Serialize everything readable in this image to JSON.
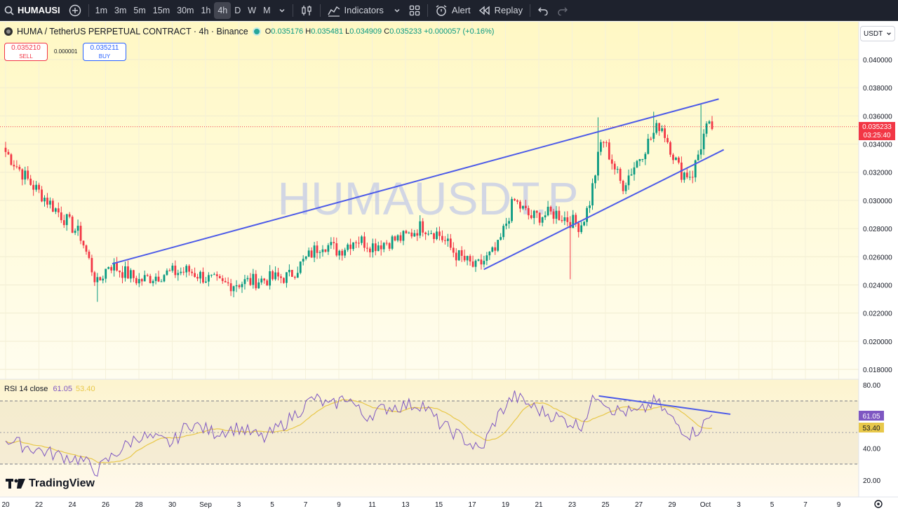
{
  "toolbar": {
    "symbol": "HUMAUSI",
    "intervals": [
      "1m",
      "3m",
      "5m",
      "15m",
      "30m",
      "1h",
      "4h",
      "D",
      "W",
      "M"
    ],
    "active_interval": "4h",
    "indicators_label": "Indicators",
    "alert_label": "Alert",
    "replay_label": "Replay"
  },
  "header": {
    "title": "HUMA / TetherUS PERPETUAL CONTRACT · 4h · Binance",
    "o_label": "O",
    "o": "0.035176",
    "h_label": "H",
    "h": "0.035481",
    "l_label": "L",
    "l": "0.034909",
    "c_label": "C",
    "c": "0.035233",
    "change": "+0.000057 (+0.16%)"
  },
  "trade": {
    "sell_price": "0.035210",
    "sell_label": "SELL",
    "buy_price": "0.035211",
    "buy_label": "BUY",
    "spread": "0.000001"
  },
  "currency": "USDT",
  "watermark": "HUMAUSDT.P",
  "colors": {
    "up": "#089981",
    "down": "#f23645",
    "trendline": "#4d5be8",
    "rsi": "#7e57c2",
    "rsi_ma": "#e8c84a",
    "bg_top": "#fff8c4"
  },
  "rsi": {
    "label": "RSI 14 close",
    "value": "61.05",
    "ma_value": "53.40"
  },
  "branding": "TradingView",
  "chart_data": [
    {
      "type": "candlestick",
      "title": "HUMA / TetherUS PERPETUAL CONTRACT · 4h · Binance",
      "y_ticks": [
        "0.040000",
        "0.038000",
        "0.036000",
        "0.034000",
        "0.032000",
        "0.030000",
        "0.028000",
        "0.026000",
        "0.024000",
        "0.022000",
        "0.020000",
        "0.018000"
      ],
      "x_ticks": [
        "20",
        "22",
        "24",
        "26",
        "28",
        "30",
        "Sep",
        "3",
        "5",
        "7",
        "9",
        "11",
        "13",
        "15",
        "17",
        "19",
        "21",
        "23",
        "25",
        "27",
        "29",
        "Oct",
        "3",
        "5",
        "7",
        "9"
      ],
      "ylim": [
        0.0172,
        0.0412
      ],
      "last_price": "0.035233",
      "countdown": "03:25:40",
      "key_points": [
        {
          "date": "Aug 19",
          "price": 0.0339
        },
        {
          "date": "Aug 22",
          "price": 0.0305
        },
        {
          "date": "Aug 25",
          "price": 0.0235
        },
        {
          "date": "Aug 26",
          "price": 0.0255
        },
        {
          "date": "Sep 2",
          "price": 0.024
        },
        {
          "date": "Sep 8",
          "price": 0.027
        },
        {
          "date": "Sep 13",
          "price": 0.0282
        },
        {
          "date": "Sep 17",
          "price": 0.0251
        },
        {
          "date": "Sep 19",
          "price": 0.0293
        },
        {
          "date": "Sep 22",
          "price": 0.0244
        },
        {
          "date": "Sep 23",
          "price": 0.0359
        },
        {
          "date": "Sep 26",
          "price": 0.0363
        },
        {
          "date": "Sep 28",
          "price": 0.0315
        },
        {
          "date": "Sep 29",
          "price": 0.0368
        },
        {
          "date": "Sep 29",
          "price": 0.0352
        }
      ]
    },
    {
      "type": "line",
      "title": "RSI 14 close",
      "y_ticks": [
        "80.00",
        "40.00",
        "20.00"
      ],
      "ylim": [
        15,
        85
      ],
      "bands": [
        70,
        50,
        30
      ],
      "series": [
        {
          "name": "RSI",
          "last": 61.05
        },
        {
          "name": "RSI-based MA",
          "last": 53.4
        }
      ]
    }
  ]
}
